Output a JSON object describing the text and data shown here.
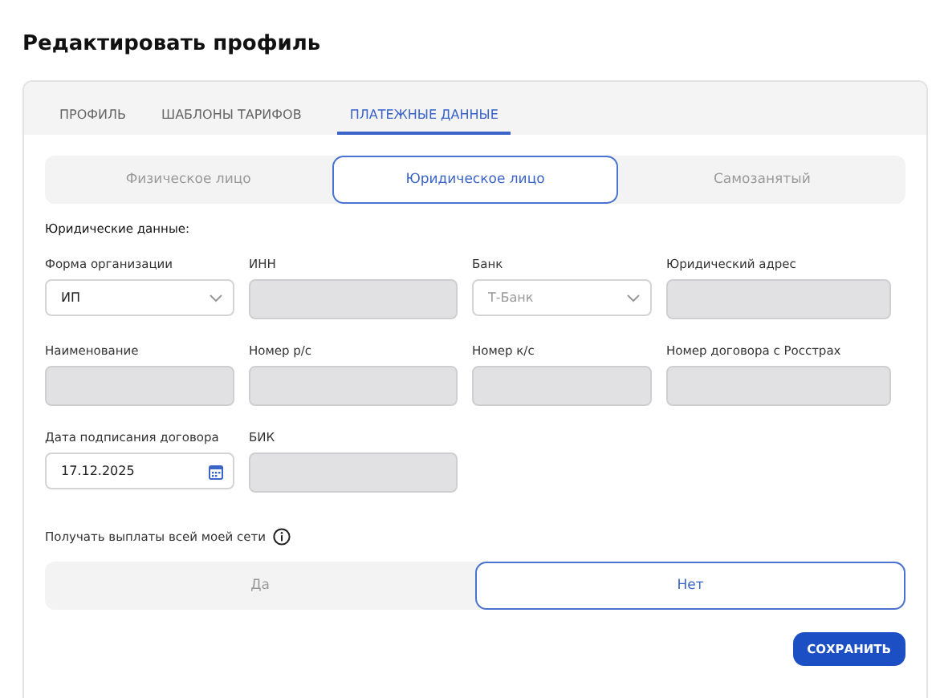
{
  "title": "Редактировать профиль",
  "tabs": [
    {
      "label": "ПРОФИЛЬ",
      "selected": false
    },
    {
      "label": "ШАБЛОНЫ ТАРИФОВ",
      "selected": false
    },
    {
      "label": "ПЛАТЕЖНЫЕ ДАННЫЕ",
      "selected": true
    }
  ],
  "entity_types": [
    {
      "label": "Физическое лицо",
      "selected": false
    },
    {
      "label": "Юридическое лицо",
      "selected": true
    },
    {
      "label": "Самозанятый",
      "selected": false
    }
  ],
  "section_title": "Юридические данные:",
  "field_rows": [
    [
      {
        "label": "Форма организации",
        "kind": "select",
        "value": "ИП"
      },
      {
        "label": "ИНН",
        "kind": "redacted"
      },
      {
        "label": "Банк",
        "kind": "select",
        "value": "Т-Банк",
        "disabled": true
      },
      {
        "label": "Юридический адрес",
        "kind": "redacted"
      }
    ],
    [
      {
        "label": "Наименование",
        "kind": "redacted"
      },
      {
        "label": "Номер р/с",
        "kind": "redacted"
      },
      {
        "label": "Номер к/с",
        "kind": "redacted"
      },
      {
        "label": "Номер договора с Росстрах",
        "kind": "redacted"
      }
    ],
    [
      {
        "label": "Дата подписания договора",
        "kind": "date",
        "value": "17.12.2025"
      },
      {
        "label": "БИК",
        "kind": "redacted"
      }
    ]
  ],
  "network_payouts": {
    "label": "Получать выплаты всей моей сети",
    "options": [
      {
        "label": "Да",
        "selected": false
      },
      {
        "label": "Нет",
        "selected": true
      }
    ]
  },
  "save_button": "СОХРАНИТЬ"
}
